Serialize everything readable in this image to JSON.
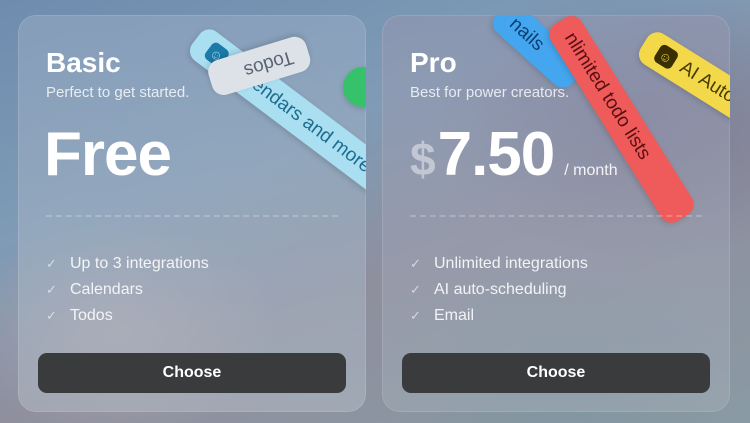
{
  "plans": [
    {
      "name": "Basic",
      "tagline": "Perfect to get started.",
      "price": "Free",
      "features": [
        "Up to 3 integrations",
        "Calendars",
        "Todos"
      ],
      "cta": "Choose",
      "pills": {
        "calendars": "Calendars and more",
        "todos": "Todos"
      }
    },
    {
      "name": "Pro",
      "tagline": "Best for power creators.",
      "currency": "$",
      "amount": "7.50",
      "period": "/ month",
      "features": [
        "Unlimited integrations",
        "AI auto-scheduling",
        "Email"
      ],
      "cta": "Choose",
      "pills": {
        "emails": "nails",
        "todo_lists": "nlimited todo lists",
        "ai": "AI Auto"
      }
    }
  ],
  "colors": {
    "button": "#3a3b3d",
    "pill_calendar": "#a9dff0",
    "pill_email": "#44a6ee",
    "pill_todo": "#ef5a5a",
    "pill_ai": "#f3d94a",
    "pill_green": "#36c26a"
  }
}
